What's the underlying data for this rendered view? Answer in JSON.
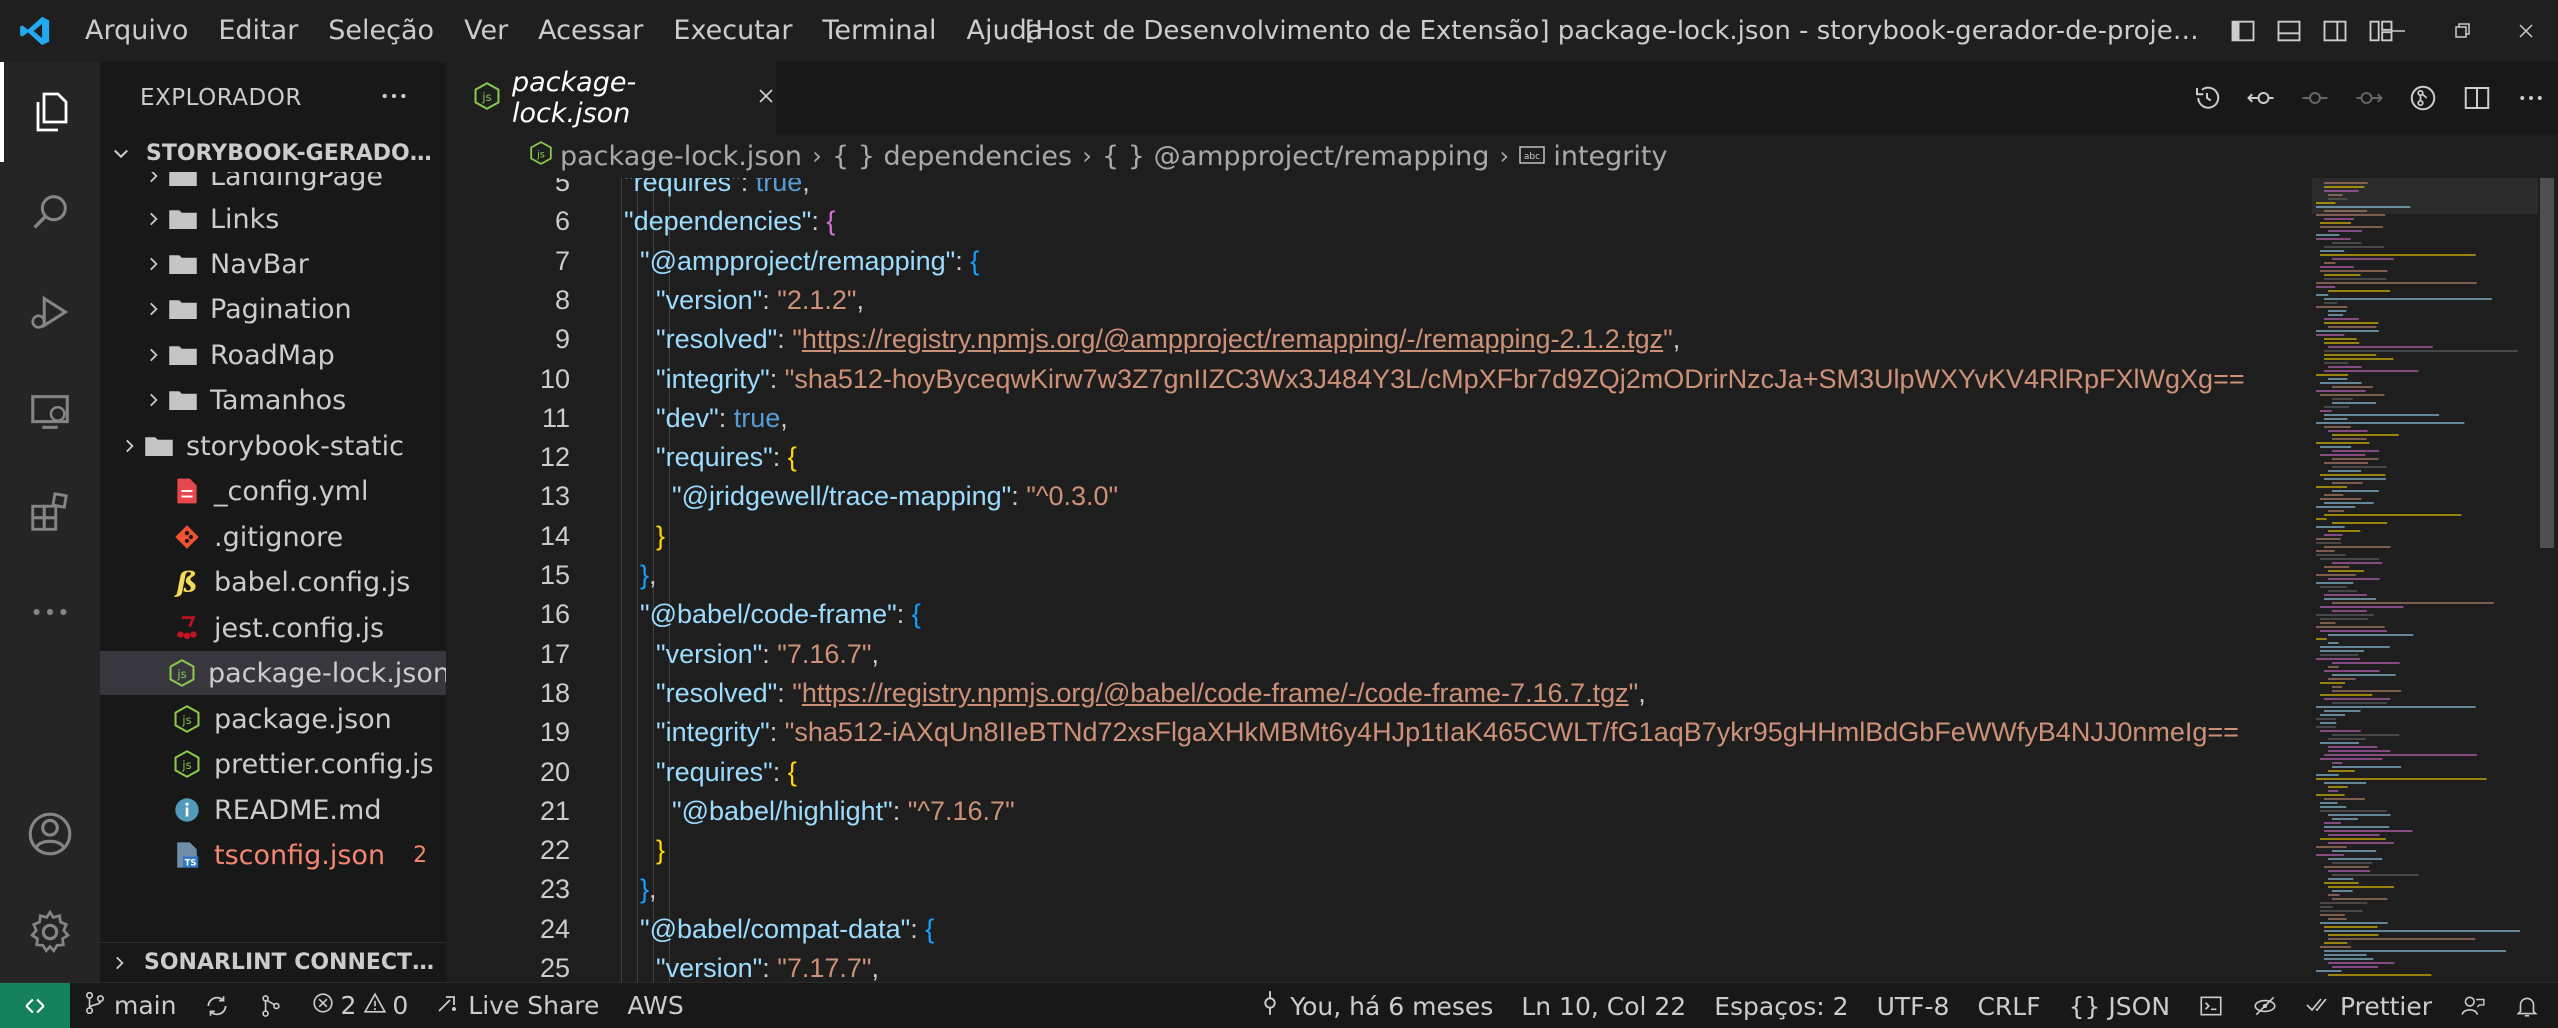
{
  "app": {
    "menu": [
      "Arquivo",
      "Editar",
      "Seleção",
      "Ver",
      "Acessar",
      "Executar",
      "Terminal",
      "Ajuda"
    ],
    "window_title": "[Host de Desenvolvimento de Extensão] package-lock.json - storybook-gerador-de-projetos - Visual Studi..."
  },
  "sidebar": {
    "header": "EXPLORADOR",
    "project": "STORYBOOK-GERADOR-D...",
    "footer_section": "SONARLINT CONNECTED ...",
    "tree": [
      {
        "label": "LandingPage",
        "type": "folder",
        "depth": 2
      },
      {
        "label": "Links",
        "type": "folder",
        "depth": 2
      },
      {
        "label": "NavBar",
        "type": "folder",
        "depth": 2
      },
      {
        "label": "Pagination",
        "type": "folder",
        "depth": 2
      },
      {
        "label": "RoadMap",
        "type": "folder",
        "depth": 2
      },
      {
        "label": "Tamanhos",
        "type": "folder",
        "depth": 2
      },
      {
        "label": "storybook-static",
        "type": "folder",
        "depth": 1
      },
      {
        "label": "_config.yml",
        "type": "yml",
        "depth": 1
      },
      {
        "label": ".gitignore",
        "type": "git",
        "depth": 1
      },
      {
        "label": "babel.config.js",
        "type": "babel",
        "depth": 1
      },
      {
        "label": "jest.config.js",
        "type": "jest",
        "depth": 1
      },
      {
        "label": "package-lock.json",
        "type": "npm",
        "depth": 1,
        "selected": true
      },
      {
        "label": "package.json",
        "type": "npm",
        "depth": 1
      },
      {
        "label": "prettier.config.js",
        "type": "npm",
        "depth": 1
      },
      {
        "label": "README.md",
        "type": "info",
        "depth": 1
      },
      {
        "label": "tsconfig.json",
        "type": "ts",
        "depth": 1,
        "errors": "2"
      }
    ]
  },
  "editor": {
    "tab_label": "package-lock.json",
    "breadcrumb": [
      "package-lock.json",
      "{ } dependencies",
      "{ } @ampproject/remapping",
      "integrity"
    ],
    "lines": [
      {
        "n": "5",
        "indent": 1,
        "parts": [
          [
            "key",
            "\"requires\""
          ],
          [
            "punc",
            ": "
          ],
          [
            "lit",
            "true"
          ],
          [
            "punc",
            ","
          ]
        ]
      },
      {
        "n": "6",
        "indent": 1,
        "parts": [
          [
            "key",
            "\"dependencies\""
          ],
          [
            "punc",
            ": "
          ],
          [
            "brace",
            "{"
          ]
        ]
      },
      {
        "n": "7",
        "indent": 2,
        "parts": [
          [
            "key",
            "\"@ampproject/remapping\""
          ],
          [
            "punc",
            ": "
          ],
          [
            "brace2",
            "{"
          ]
        ]
      },
      {
        "n": "8",
        "indent": 3,
        "parts": [
          [
            "key",
            "\"version\""
          ],
          [
            "punc",
            ": "
          ],
          [
            "str",
            "\"2.1.2\""
          ],
          [
            "punc",
            ","
          ]
        ]
      },
      {
        "n": "9",
        "indent": 3,
        "parts": [
          [
            "key",
            "\"resolved\""
          ],
          [
            "punc",
            ": "
          ],
          [
            "str",
            "\""
          ],
          [
            "url",
            "https://registry.npmjs.org/@ampproject/remapping/-/remapping-2.1.2.tgz"
          ],
          [
            "str",
            "\""
          ],
          [
            "punc",
            ","
          ]
        ]
      },
      {
        "n": "10",
        "indent": 3,
        "parts": [
          [
            "key",
            "\"integrity\""
          ],
          [
            "punc",
            ": "
          ],
          [
            "str",
            "\"sha512-hoyByceqwKirw7w3Z7gnIIZC3Wx3J484Y3L/cMpXFbr7d9ZQj2mODrirNzcJa+SM3UlpWXYvKV4RlRpFXlWgXg=="
          ]
        ]
      },
      {
        "n": "11",
        "indent": 3,
        "parts": [
          [
            "key",
            "\"dev\""
          ],
          [
            "punc",
            ": "
          ],
          [
            "lit",
            "true"
          ],
          [
            "punc",
            ","
          ]
        ]
      },
      {
        "n": "12",
        "indent": 3,
        "parts": [
          [
            "key",
            "\"requires\""
          ],
          [
            "punc",
            ": "
          ],
          [
            "brace3",
            "{"
          ]
        ]
      },
      {
        "n": "13",
        "indent": 4,
        "parts": [
          [
            "key",
            "\"@jridgewell/trace-mapping\""
          ],
          [
            "punc",
            ": "
          ],
          [
            "str",
            "\"^0.3.0\""
          ]
        ]
      },
      {
        "n": "14",
        "indent": 3,
        "parts": [
          [
            "brace3",
            "}"
          ]
        ]
      },
      {
        "n": "15",
        "indent": 2,
        "parts": [
          [
            "brace2",
            "}"
          ],
          [
            "punc",
            ","
          ]
        ]
      },
      {
        "n": "16",
        "indent": 2,
        "parts": [
          [
            "key",
            "\"@babel/code-frame\""
          ],
          [
            "punc",
            ": "
          ],
          [
            "brace2",
            "{"
          ]
        ]
      },
      {
        "n": "17",
        "indent": 3,
        "parts": [
          [
            "key",
            "\"version\""
          ],
          [
            "punc",
            ": "
          ],
          [
            "str",
            "\"7.16.7\""
          ],
          [
            "punc",
            ","
          ]
        ]
      },
      {
        "n": "18",
        "indent": 3,
        "parts": [
          [
            "key",
            "\"resolved\""
          ],
          [
            "punc",
            ": "
          ],
          [
            "str",
            "\""
          ],
          [
            "url",
            "https://registry.npmjs.org/@babel/code-frame/-/code-frame-7.16.7.tgz"
          ],
          [
            "str",
            "\""
          ],
          [
            "punc",
            ","
          ]
        ]
      },
      {
        "n": "19",
        "indent": 3,
        "parts": [
          [
            "key",
            "\"integrity\""
          ],
          [
            "punc",
            ": "
          ],
          [
            "str",
            "\"sha512-iAXqUn8IIeBTNd72xsFlgaXHkMBMt6y4HJp1tIaK465CWLT/fG1aqB7ykr95gHHmlBdGbFeWWfyB4NJJ0nmeIg=="
          ]
        ]
      },
      {
        "n": "20",
        "indent": 3,
        "parts": [
          [
            "key",
            "\"requires\""
          ],
          [
            "punc",
            ": "
          ],
          [
            "brace3",
            "{"
          ]
        ]
      },
      {
        "n": "21",
        "indent": 4,
        "parts": [
          [
            "key",
            "\"@babel/highlight\""
          ],
          [
            "punc",
            ": "
          ],
          [
            "str",
            "\"^7.16.7\""
          ]
        ]
      },
      {
        "n": "22",
        "indent": 3,
        "parts": [
          [
            "brace3",
            "}"
          ]
        ]
      },
      {
        "n": "23",
        "indent": 2,
        "parts": [
          [
            "brace2",
            "}"
          ],
          [
            "punc",
            ","
          ]
        ]
      },
      {
        "n": "24",
        "indent": 2,
        "parts": [
          [
            "key",
            "\"@babel/compat-data\""
          ],
          [
            "punc",
            ": "
          ],
          [
            "brace2",
            "{"
          ]
        ]
      },
      {
        "n": "25",
        "indent": 3,
        "parts": [
          [
            "key",
            "\"version\""
          ],
          [
            "punc",
            ": "
          ],
          [
            "str",
            "\"7.17.7\""
          ],
          [
            "punc",
            ","
          ]
        ]
      }
    ]
  },
  "statusbar": {
    "branch": "main",
    "errors": "2",
    "warnings": "0",
    "live_share": "Live Share",
    "aws": "AWS",
    "blame": "You, há 6 meses",
    "position": "Ln 10, Col 22",
    "spaces": "Espaços: 2",
    "encoding": "UTF-8",
    "eol": "CRLF",
    "language": "JSON",
    "prettier": "Prettier"
  },
  "colors": {
    "accent": "#007acc",
    "remote": "#16825d",
    "key": "#9cdcfe",
    "string": "#ce9178",
    "error": "#f48771"
  }
}
